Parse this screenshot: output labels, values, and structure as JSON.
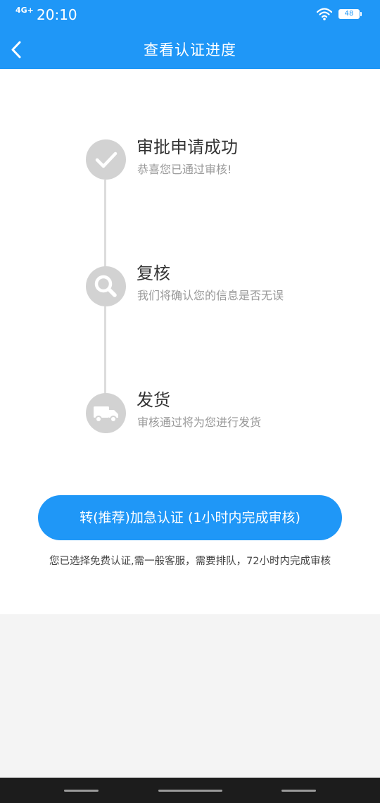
{
  "status_bar": {
    "network": "4G+",
    "time": "20:10",
    "battery": "48"
  },
  "nav": {
    "title": "查看认证进度",
    "back_icon": "chevron-left-icon"
  },
  "steps": [
    {
      "title": "审批申请成功",
      "desc": "恭喜您已通过审核!",
      "icon": "checkmark-icon"
    },
    {
      "title": "复核",
      "desc": "我们将确认您的信息是否无误",
      "icon": "search-icon"
    },
    {
      "title": "发货",
      "desc": "审核通过将为您进行发货",
      "icon": "truck-icon"
    }
  ],
  "action": {
    "label": "转(推荐)加急认证 (1小时内完成审核)"
  },
  "notice": "您已选择免费认证,需一般客服，需要排队，72小时内完成审核",
  "colors": {
    "brand": "#1f97f7",
    "step_icon": "#d2d2d2",
    "line": "#dcdcdc"
  }
}
